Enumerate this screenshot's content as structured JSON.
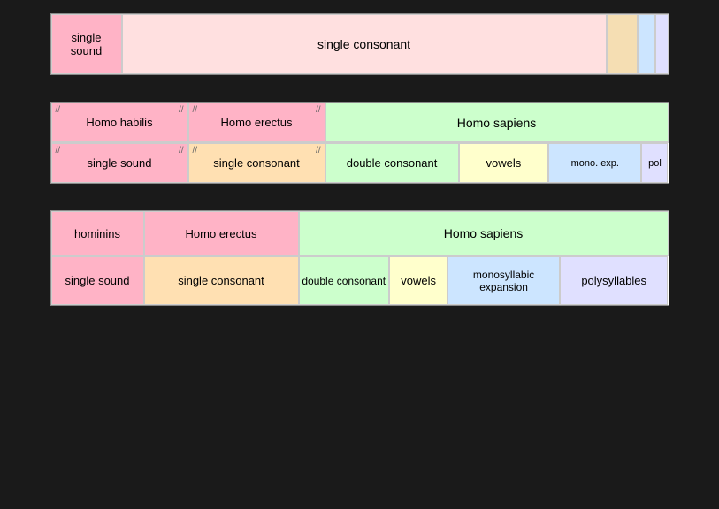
{
  "diagram1": {
    "single_sound": "single\nsound",
    "single_consonant": "single consonant"
  },
  "diagram2": {
    "header": {
      "homo_habilis": "Homo habilis",
      "homo_erectus": "Homo erectus",
      "homo_sapiens": "Homo sapiens"
    },
    "data": {
      "single_sound": "single sound",
      "single_consonant": "single consonant",
      "double_consonant": "double consonant",
      "vowels": "vowels",
      "mono_exp": "mono.\nexp.",
      "pol": "pol"
    }
  },
  "diagram3": {
    "header": {
      "hominins": "hominins",
      "homo_erectus": "Homo erectus",
      "homo_sapiens": "Homo sapiens"
    },
    "data": {
      "single_sound": "single sound",
      "single_consonant": "single consonant",
      "double_consonant": "double\nconsonant",
      "vowels": "vowels",
      "monosyllabic": "monosyllabic\nexpansion",
      "polysyllables": "polysyllables"
    }
  }
}
